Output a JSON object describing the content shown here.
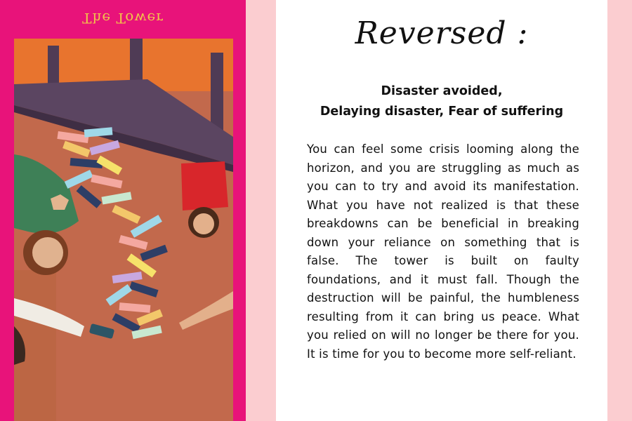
{
  "card": {
    "title": "The Tower"
  },
  "panel": {
    "heading": "Reversed :",
    "subtitle_line1": "Disaster avoided,",
    "subtitle_line2": "Delaying disaster, Fear of suffering",
    "body": "You can feel some crisis looming along the horizon, and you are struggling as much as you can to try and avoid its manifestation. What you have not realized is that these breakdowns can be beneficial in breaking down your reliance on something that is false. The tower is built on faulty foundations, and it must fall. Though the destruction will be painful, the humbleness resulting from it can bring us peace. What you relied on will no longer be there for you. It is time for you to become more self-reliant."
  },
  "colors": {
    "card_border": "#e8137a",
    "title_gold": "#f1c44a",
    "background_pink": "#fbcdd0",
    "sky_orange": "#e8742e",
    "floor_terracotta": "#c2694c",
    "table_purple": "#5b4561"
  }
}
